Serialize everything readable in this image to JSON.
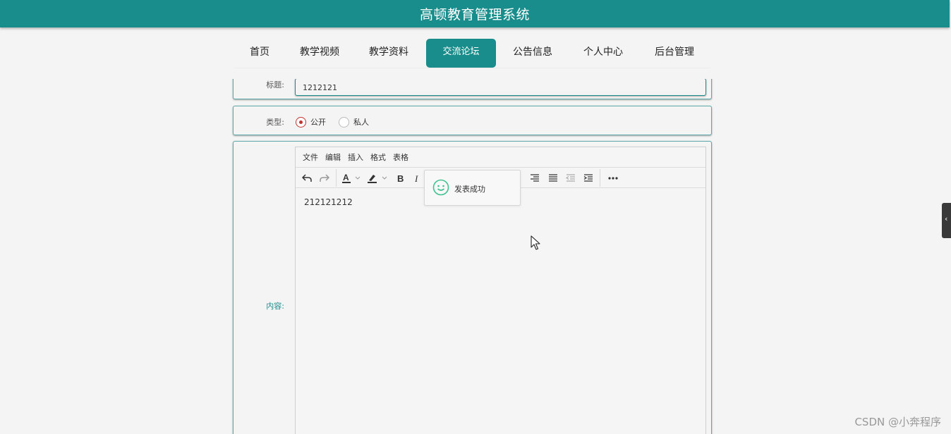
{
  "header": {
    "title": "高顿教育管理系统"
  },
  "nav": [
    {
      "label": "首页",
      "active": false
    },
    {
      "label": "教学视频",
      "active": false
    },
    {
      "label": "教学资料",
      "active": false
    },
    {
      "label": "交流论坛",
      "active": true
    },
    {
      "label": "公告信息",
      "active": false
    },
    {
      "label": "个人中心",
      "active": false
    },
    {
      "label": "后台管理",
      "active": false
    }
  ],
  "form": {
    "title_label": "标题:",
    "title_value": "1212121",
    "type_label": "类型:",
    "type_options": [
      {
        "label": "公开",
        "checked": true
      },
      {
        "label": "私人",
        "checked": false
      }
    ],
    "content_label": "内容:"
  },
  "editor": {
    "menus": [
      "文件",
      "编辑",
      "插入",
      "格式",
      "表格"
    ],
    "toolbar_icons": [
      "undo-icon",
      "redo-icon",
      "font-color-icon",
      "highlight-icon",
      "bold-icon",
      "italic-icon",
      "align-right-icon",
      "justify-icon",
      "outdent-icon",
      "indent-icon",
      "more-icon"
    ],
    "content": "212121212"
  },
  "toast": {
    "message": "发表成功",
    "icon": "smile-icon"
  },
  "watermark": "CSDN @小奔程序",
  "colors": {
    "primary": "#198c8c",
    "radio_checked": "#c2332f",
    "toast_icon": "#3ec28f"
  }
}
